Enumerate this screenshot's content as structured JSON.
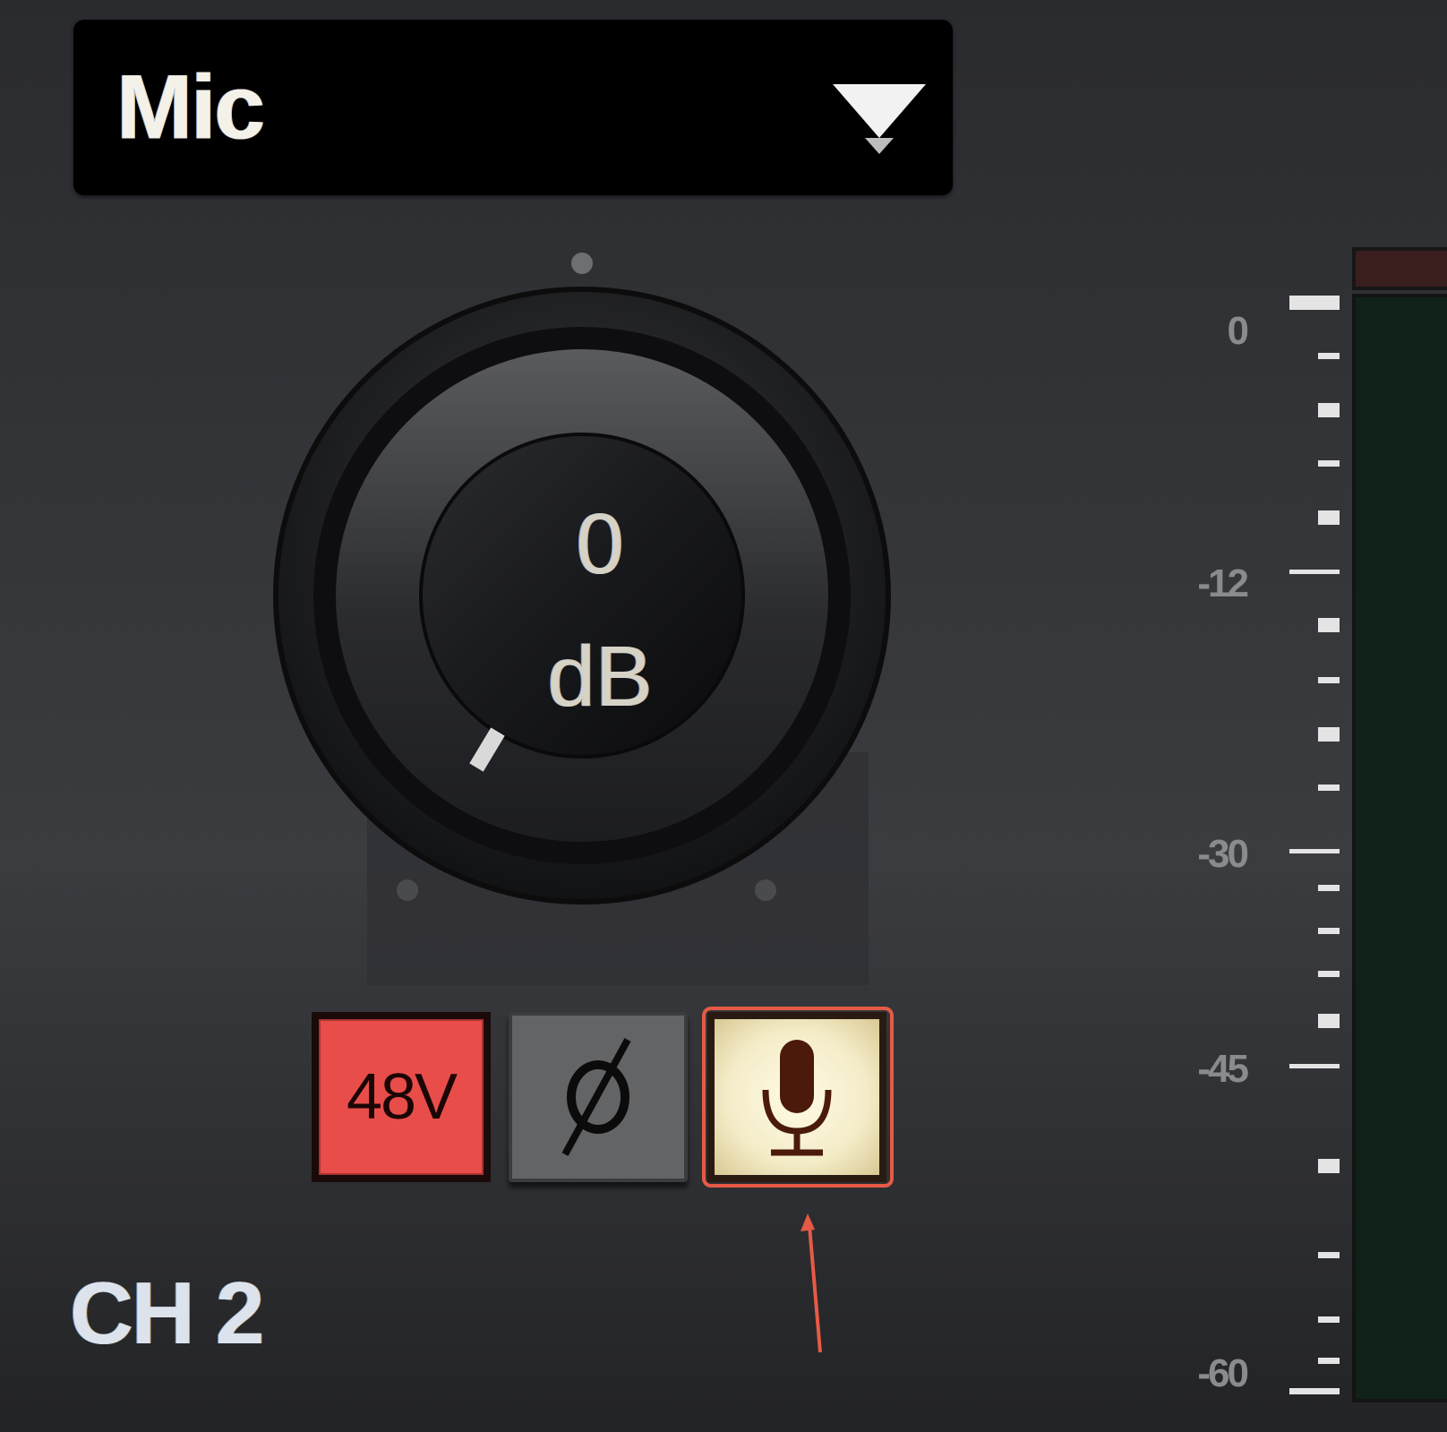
{
  "input_selector": {
    "value": "Mic",
    "dropdown_icon": "triangle-down-icon"
  },
  "gain_knob": {
    "value": "0",
    "unit": "dB"
  },
  "buttons": {
    "phantom_power_label": "48V",
    "phase_invert_symbol": "ø",
    "mic_icon": "microphone-icon"
  },
  "channel": {
    "label": "CH 2"
  },
  "meter_scale": {
    "labels": [
      "0",
      "-12",
      "-30",
      "-45",
      "-60"
    ]
  },
  "colors": {
    "phantom_active": "#e84d4a",
    "mic_active": "#f7f0d2",
    "highlight": "#e65a45",
    "meter_bg": "#10211a"
  }
}
